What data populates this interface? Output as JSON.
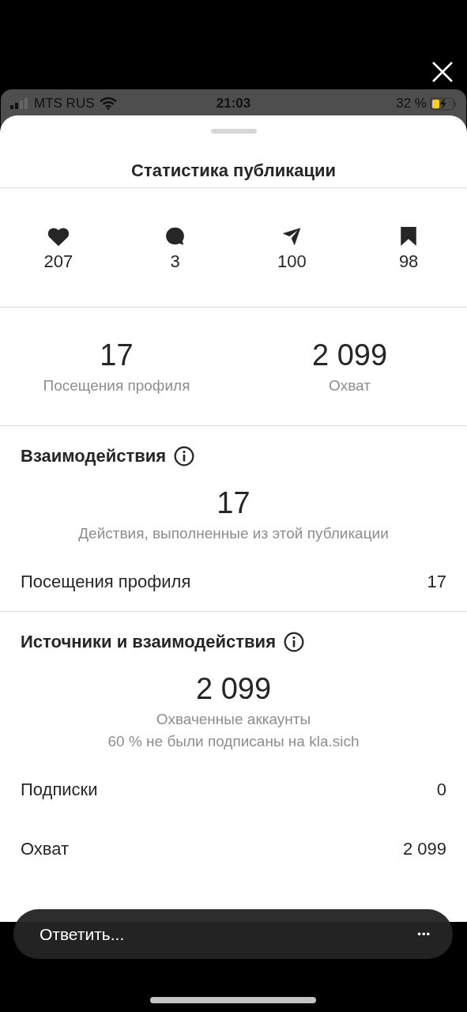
{
  "status_bar": {
    "carrier": "MTS RUS",
    "time": "21:03",
    "battery": "32 %"
  },
  "sheet": {
    "title": "Статистика публикации",
    "counts": [
      {
        "kind": "like",
        "value": "207"
      },
      {
        "kind": "comment",
        "value": "3"
      },
      {
        "kind": "share",
        "value": "100"
      },
      {
        "kind": "save",
        "value": "98"
      }
    ],
    "summary": [
      {
        "value": "17",
        "label": "Посещения профиля"
      },
      {
        "value": "2 099",
        "label": "Охват"
      }
    ],
    "sections": [
      {
        "title": "Взаимодействия",
        "value": "17",
        "captions": [
          "Действия, выполненные из этой публикации"
        ],
        "rows": [
          {
            "label": "Посещения профиля",
            "value": "17"
          }
        ]
      },
      {
        "title": "Источники и взаимодействия",
        "value": "2 099",
        "captions": [
          "Охваченные аккаунты",
          "60 % не были подписаны на kla.sich"
        ],
        "rows": [
          {
            "label": "Подписки",
            "value": "0"
          },
          {
            "label": "Охват",
            "value": "2 099"
          }
        ]
      }
    ]
  },
  "reply_bar": {
    "placeholder": "Ответить...",
    "more": "•••"
  }
}
